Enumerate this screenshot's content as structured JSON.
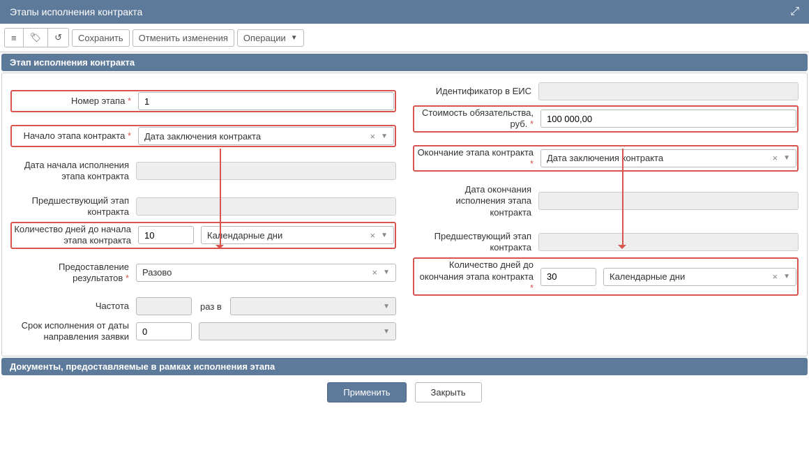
{
  "header": {
    "title": "Этапы исполнения контракта"
  },
  "toolbar": {
    "save": "Сохранить",
    "cancel": "Отменить изменения",
    "ops": "Операции"
  },
  "section1": {
    "title": "Этап исполнения контракта"
  },
  "left": {
    "num_label": "Номер этапа",
    "num_value": "1",
    "start_label": "Начало этапа контракта",
    "start_value": "Дата заключения контракта",
    "date_start_label": "Дата начала исполнения этапа контракта",
    "prev_stage_label": "Предшествующий этап контракта",
    "days_label": "Количество дней до начала этапа контракта",
    "days_value": "10",
    "days_type": "Календарные дни",
    "provide_label": "Предоставление результатов",
    "provide_value": "Разово",
    "freq_label": "Частота",
    "freq_mid": "раз в",
    "deadline_label": "Срок исполнения от даты направления заявки",
    "deadline_value": "0"
  },
  "right": {
    "eis_label": "Идентификатор в ЕИС",
    "cost_label": "Стоимость обязательства, руб.",
    "cost_value": "100 000,00",
    "end_label": "Окончание этапа контракта",
    "end_value": "Дата заключения контракта",
    "date_end_label": "Дата окончания исполнения этапа контракта",
    "prev_stage_label": "Предшествующий этап контракта",
    "days_label": "Количество дней до окончания этапа контракта",
    "days_value": "30",
    "days_type": "Календарные дни"
  },
  "section2": {
    "title": "Документы, предоставляемые в рамках исполнения этапа"
  },
  "footer": {
    "apply": "Применить",
    "close": "Закрыть"
  }
}
